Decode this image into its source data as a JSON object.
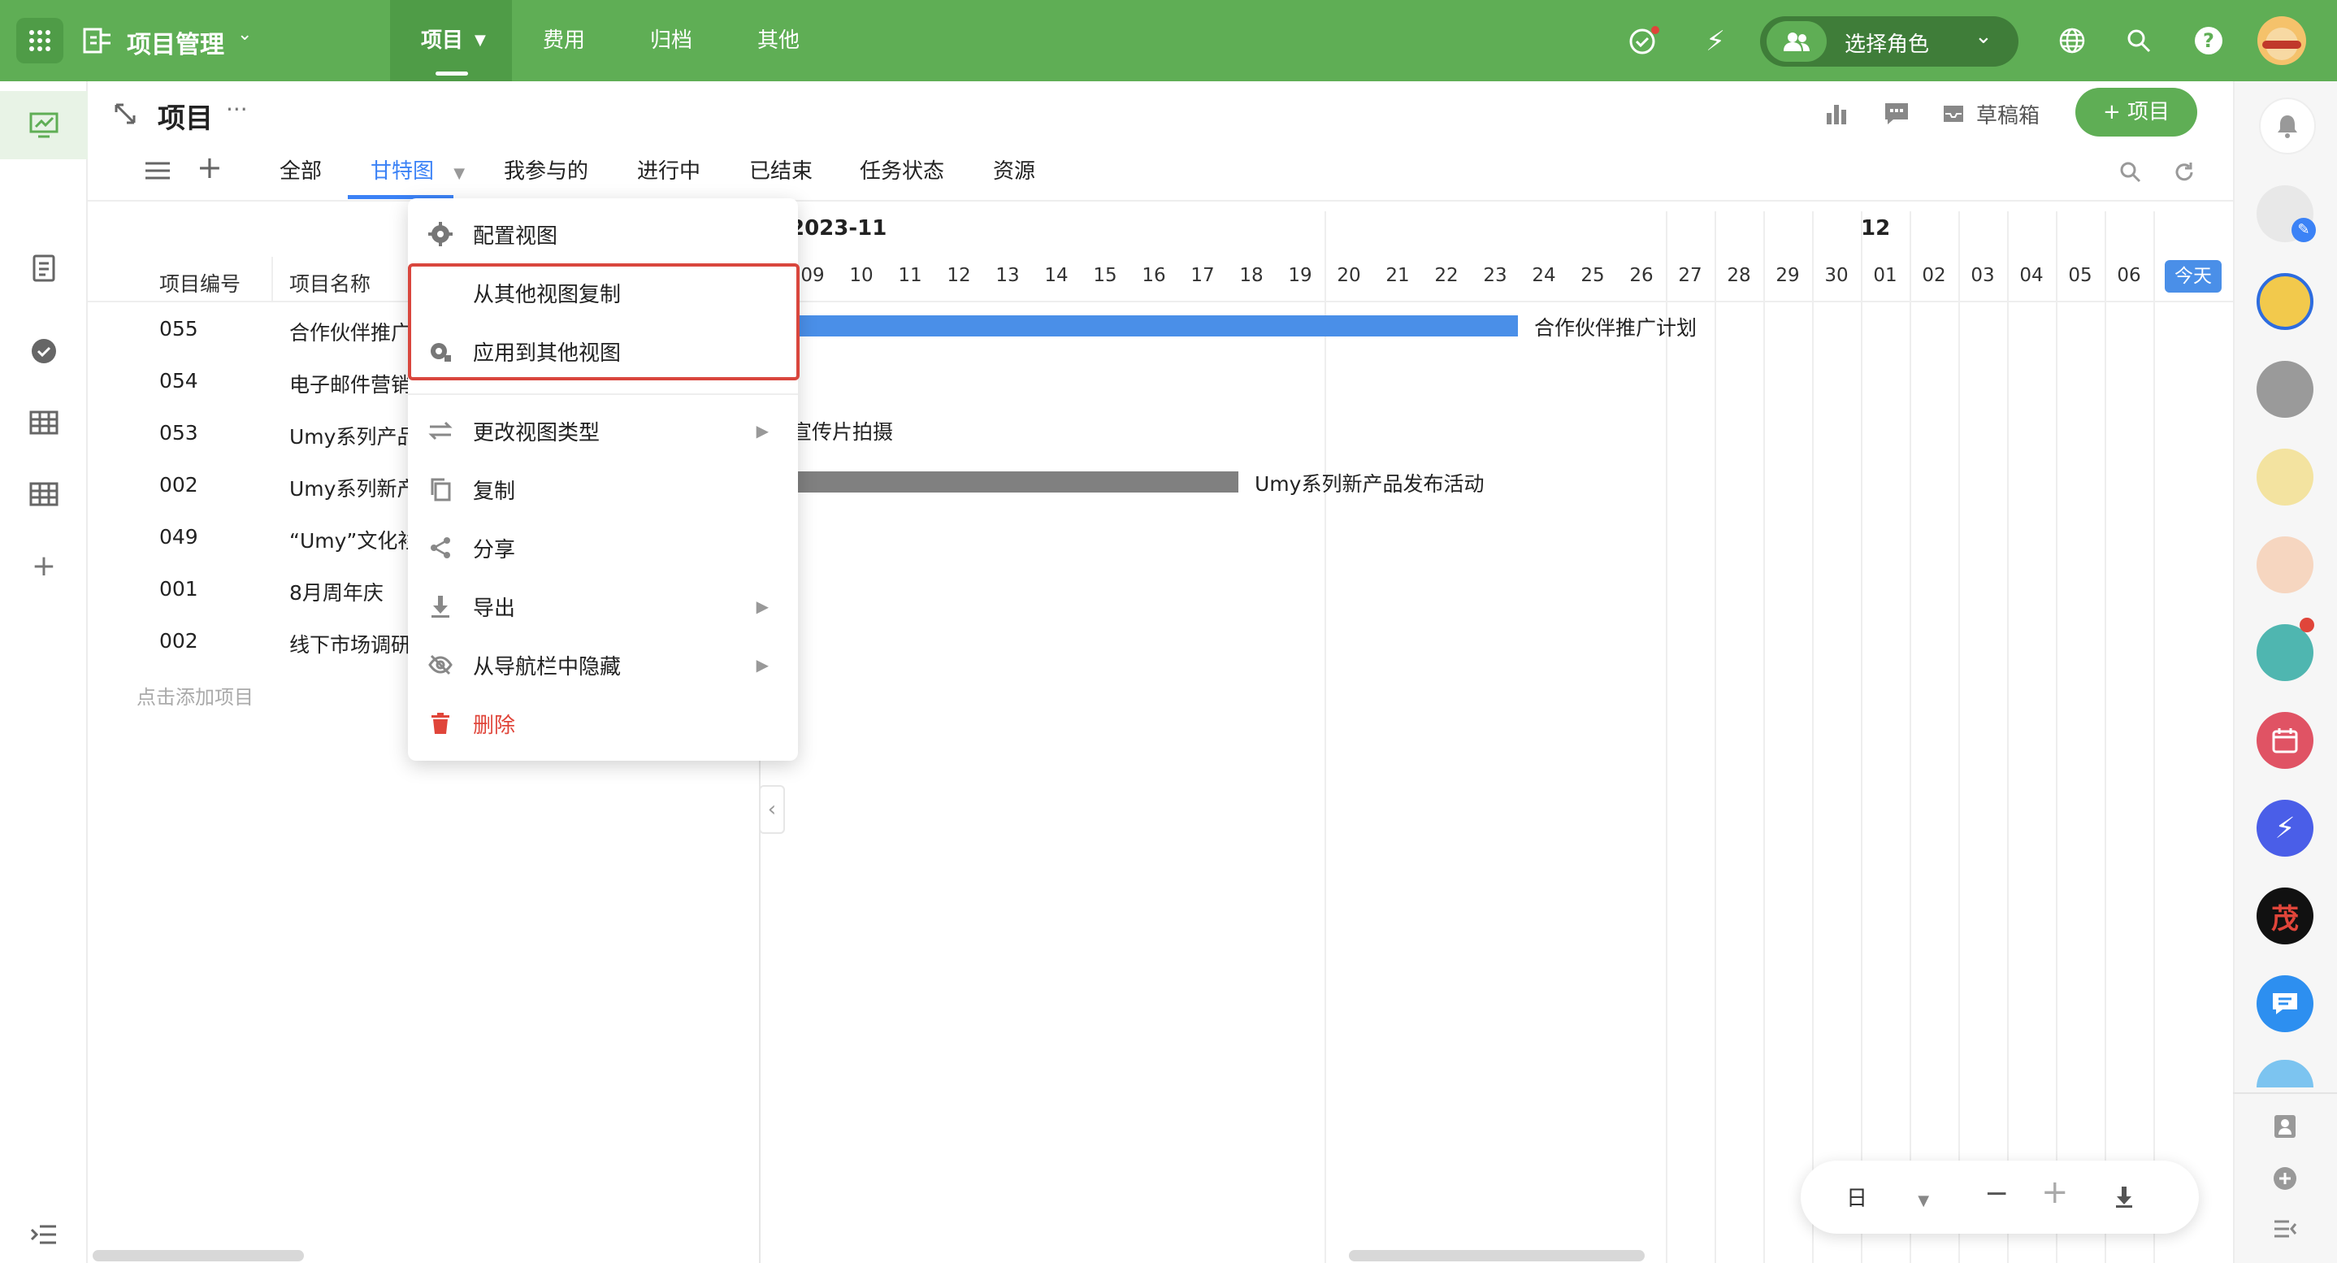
{
  "app": {
    "name": "项目管理",
    "top_tabs": [
      "项目",
      "费用",
      "归档",
      "其他"
    ],
    "role_select": "选择角色"
  },
  "page": {
    "title": "项目",
    "drafts": "草稿箱",
    "new_button": "+ 项目"
  },
  "view_tabs": [
    "全部",
    "甘特图",
    "我参与的",
    "进行中",
    "已结束",
    "任务状态",
    "资源"
  ],
  "menu": {
    "config": "配置视图",
    "copy_from": "从其他视图复制",
    "apply_to": "应用到其他视图",
    "change_type": "更改视图类型",
    "duplicate": "复制",
    "share": "分享",
    "export": "导出",
    "hide_nav": "从导航栏中隐藏",
    "delete": "删除"
  },
  "table": {
    "col_no": "项目编号",
    "col_name": "项目名称",
    "add_row": "点击添加项目",
    "rows": [
      {
        "no": "055",
        "name": "合作伙伴推广计划"
      },
      {
        "no": "054",
        "name": "电子邮件营销"
      },
      {
        "no": "053",
        "name": "Umy系列产品宣传片拍摄"
      },
      {
        "no": "002",
        "name": "Umy系列新产品发布活动"
      },
      {
        "no": "049",
        "name": "“Umy”文化衫"
      },
      {
        "no": "001",
        "name": "8月周年庆"
      },
      {
        "no": "002",
        "name": "线下市场调研"
      }
    ]
  },
  "gantt": {
    "month_left": "2023-11",
    "month_right": "12",
    "days": [
      "09",
      "10",
      "11",
      "12",
      "13",
      "14",
      "15",
      "16",
      "17",
      "18",
      "19",
      "20",
      "21",
      "22",
      "23",
      "24",
      "25",
      "26",
      "27",
      "28",
      "29",
      "30",
      "01",
      "02",
      "03",
      "04",
      "05",
      "06"
    ],
    "today": "今天",
    "bars": [
      {
        "label": "合作伙伴推广计划",
        "color": "#4a8fe8"
      },
      {
        "label": "宣传片拍摄",
        "color": null
      },
      {
        "label": "Umy系列新产品发布活动",
        "color": "#808080"
      }
    ]
  },
  "zoom": {
    "unit": "日"
  },
  "colors": {
    "brand": "#5fae55",
    "accent": "#3b82f6",
    "danger": "#e0453a"
  }
}
